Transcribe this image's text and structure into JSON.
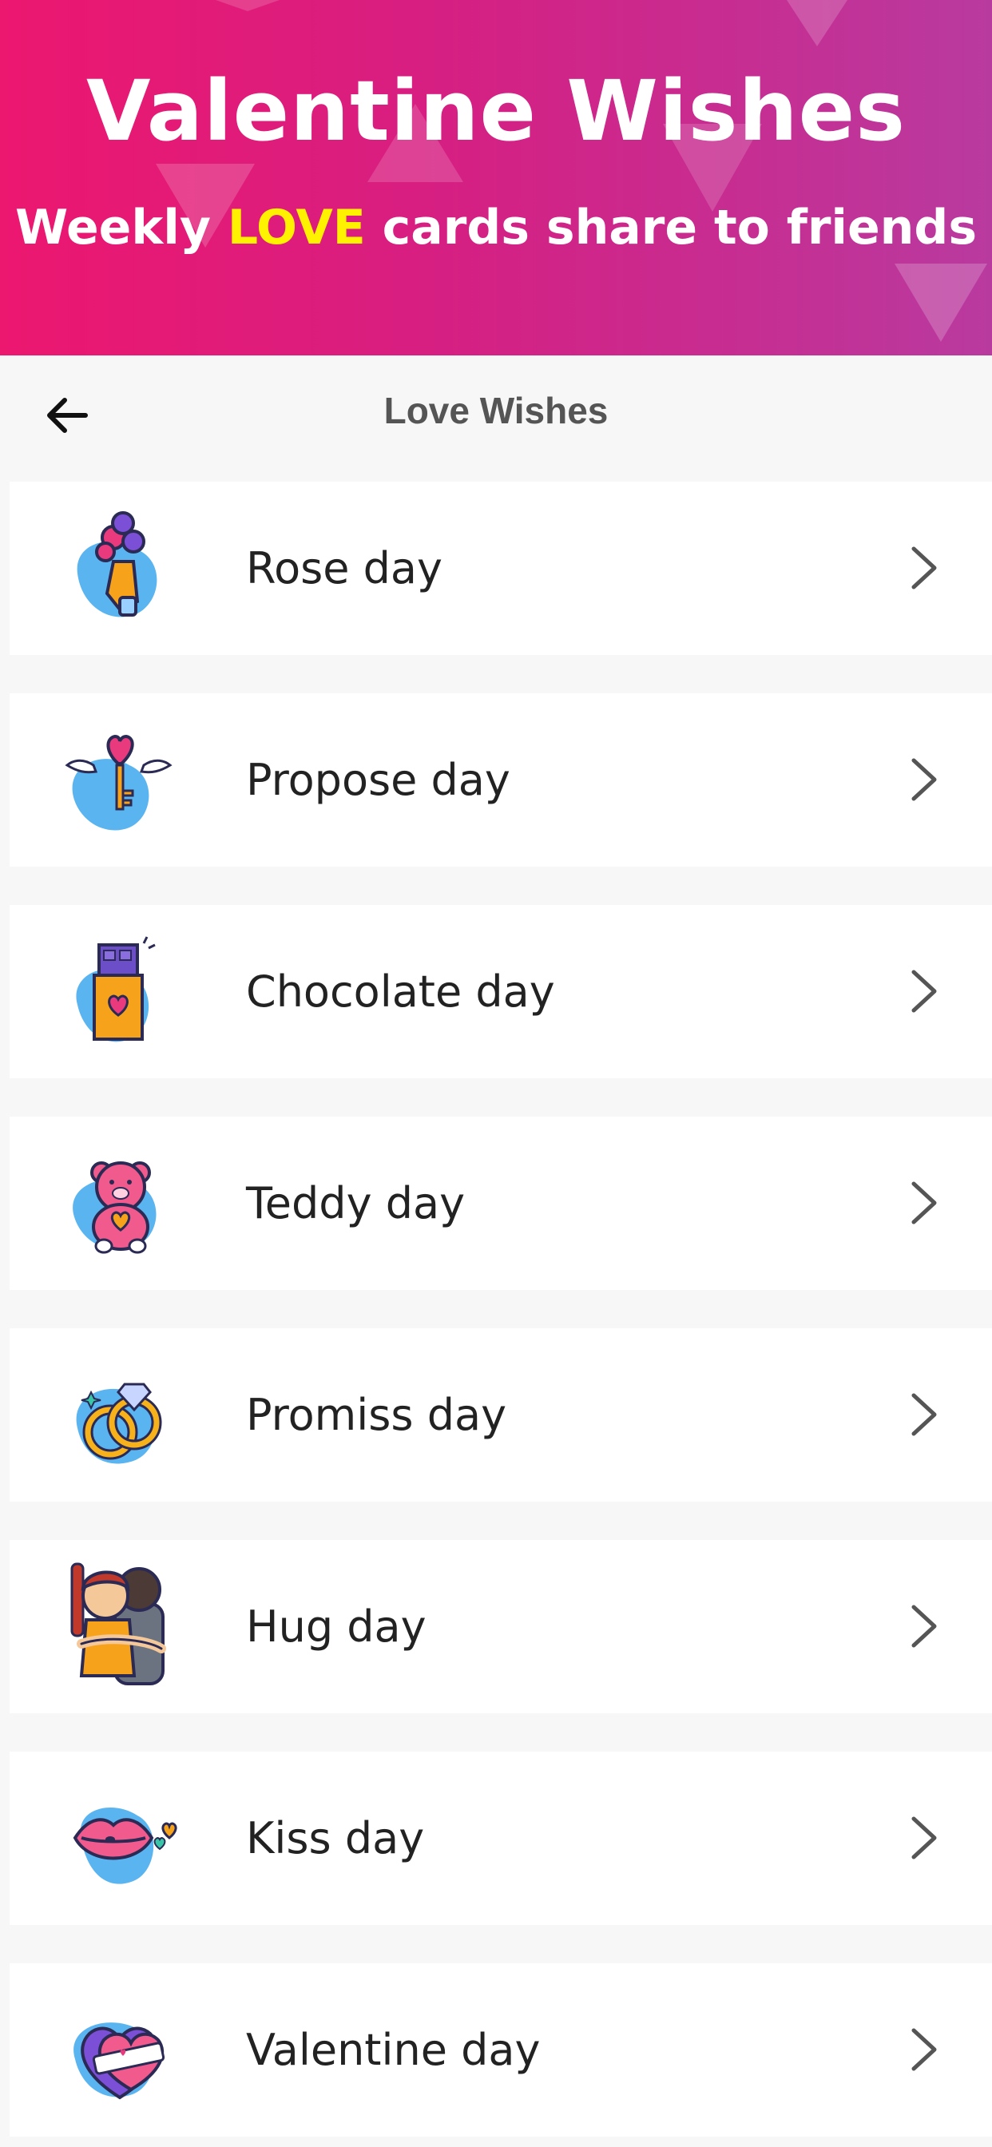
{
  "banner": {
    "title": "Valentine Wishes",
    "subtitle_before": "Weekly ",
    "subtitle_highlight": "LOVE",
    "subtitle_after": " cards share to friends",
    "highlight_color": "#fff200"
  },
  "appbar": {
    "title": "Love Wishes",
    "back_icon": "arrow-left-icon"
  },
  "items": [
    {
      "label": "Rose day",
      "icon": "rose-bouquet-icon"
    },
    {
      "label": "Propose day",
      "icon": "winged-heart-key-icon"
    },
    {
      "label": "Chocolate day",
      "icon": "chocolate-bar-icon"
    },
    {
      "label": "Teddy day",
      "icon": "teddy-bear-icon"
    },
    {
      "label": "Promiss day",
      "icon": "rings-icon"
    },
    {
      "label": "Hug day",
      "icon": "hugging-couple-icon"
    },
    {
      "label": "Kiss day",
      "icon": "lips-icon"
    },
    {
      "label": "Valentine day",
      "icon": "heart-ribbon-icon"
    }
  ],
  "colors": {
    "banner_start": "#ec176f",
    "banner_end": "#b93a9f",
    "icon_blob": "#5ab4f0"
  }
}
